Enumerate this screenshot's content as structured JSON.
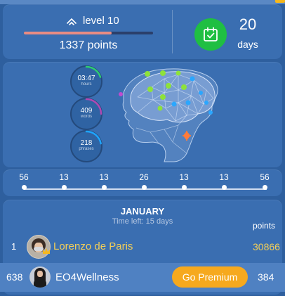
{
  "header": {
    "level_label": "level 10",
    "level_progress": 0.68,
    "points_label": "1337 points",
    "days_count": "20",
    "days_label": "days"
  },
  "stats": [
    {
      "value": "03:47",
      "unit": "hours",
      "progress": 0.2,
      "color": "#2ecc71"
    },
    {
      "value": "409",
      "unit": "words",
      "progress": 0.25,
      "color": "#b049b3"
    },
    {
      "value": "218",
      "unit": "phrases",
      "progress": 0.22,
      "color": "#1ea5ff"
    }
  ],
  "timeline": [
    "56",
    "13",
    "13",
    "26",
    "13",
    "13",
    "56"
  ],
  "leaderboard": {
    "month": "JANUARY",
    "time_left": "Time left: 15 days",
    "points_header": "points",
    "top": {
      "rank": "1",
      "name": "Lorenzo de Paris",
      "points": "30866"
    },
    "me": {
      "rank": "638",
      "name": "EO4Wellness",
      "points": "384"
    },
    "premium_label": "Go Premium"
  },
  "colors": {
    "background": "#2e5f9e",
    "card": "#3a6eb1",
    "gold": "#f4cf57",
    "premium": "#f6a91e",
    "calendar": "#1fbf42",
    "progress": "#e88c83"
  },
  "icons": [
    "chevron-up-icon",
    "calendar-check-icon",
    "crown-icon"
  ]
}
